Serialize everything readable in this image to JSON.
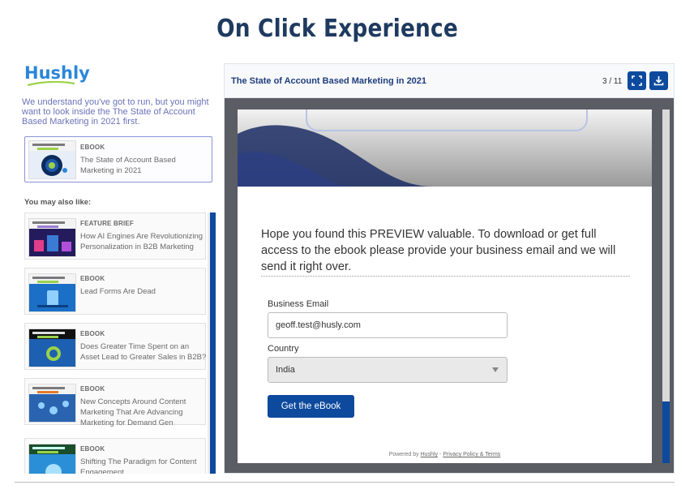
{
  "heading": "On Click Experience",
  "brand": {
    "logo_text": "Hushly",
    "accent": "#0d4a9e",
    "logo_color": "#2b86d9"
  },
  "sidebar": {
    "intro": "We understand you've got to run, but you might want to look inside the The State of Account Based Marketing in 2021 first.",
    "featured": {
      "type": "EBOOK",
      "title": "The State of Account Based Marketing in 2021"
    },
    "also_like_label": "You may also like:",
    "items": [
      {
        "type": "FEATURE BRIEF",
        "title": "How AI Engines Are Revolutionizing Personalization in B2B Marketing"
      },
      {
        "type": "EBOOK",
        "title": "Lead Forms Are Dead"
      },
      {
        "type": "EBOOK",
        "title": "Does Greater Time Spent on an Asset Lead to Greater Sales in B2B?"
      },
      {
        "type": "EBOOK",
        "title": "New Concepts Around Content Marketing That Are Advancing Marketing for Demand Gen"
      },
      {
        "type": "EBOOK",
        "title": "Shifting The Paradigm for Content Engagement"
      }
    ]
  },
  "viewer": {
    "title": "The State of Account Based Marketing in 2021",
    "page_indicator": "3 / 11",
    "fullscreen_icon": "fullscreen-icon",
    "download_icon": "download-icon"
  },
  "gate": {
    "message": "Hope you found this PREVIEW valuable. To download or get full access to the ebook please provide your business email and we will send it right over.",
    "email_label": "Business Email",
    "email_value": "geoff.test@husly.com",
    "country_label": "Country",
    "country_value": "India",
    "button_label": "Get the eBook",
    "powered_prefix": "Powered by ",
    "powered_brand": "Hushly",
    "powered_sep": " - ",
    "powered_link": "Privacy Policy & Terms"
  }
}
